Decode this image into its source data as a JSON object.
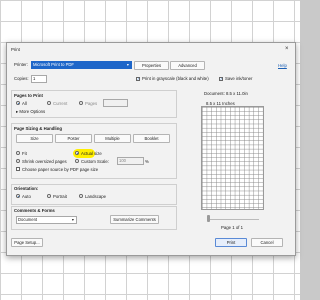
{
  "dialog": {
    "title": "Print",
    "help": "Help",
    "printer_label": "Printer:",
    "printer_value": "Microsoft Print to PDF",
    "properties_button": "Properties",
    "advanced_button": "Advanced",
    "copies_label": "Copies:",
    "copies_value": "1",
    "grayscale_label": "Print in grayscale (black and white)",
    "save_ink_label": "Save ink/toner",
    "pages_to_print": {
      "heading": "Pages to Print",
      "all": "All",
      "current": "Current",
      "pages": "Pages",
      "more_options": "More Options"
    },
    "page_sizing": {
      "heading": "Page Sizing & Handling",
      "tabs": [
        "Size",
        "Poster",
        "Multiple",
        "Booklet"
      ],
      "fit": "Fit",
      "actual_size": "Actual size",
      "shrink": "Shrink oversized pages",
      "custom_scale": "Custom Scale:",
      "custom_scale_value": "100",
      "percent": "%",
      "choose_paper": "Choose paper source by PDF page size"
    },
    "orientation": {
      "heading": "Orientation:",
      "auto": "Auto",
      "portrait": "Portrait",
      "landscape": "Landscape"
    },
    "comments": {
      "heading": "Comments & Forms",
      "value": "Document",
      "summarize": "Summarize Comments"
    },
    "preview": {
      "document_size": "Document: 8.5 x 11.0in",
      "page_size": "8.5 x 11 Inches",
      "page_indicator": "Page 1 of 1"
    },
    "page_setup": "Page Setup...",
    "print_button": "Print",
    "cancel_button": "Cancel"
  }
}
